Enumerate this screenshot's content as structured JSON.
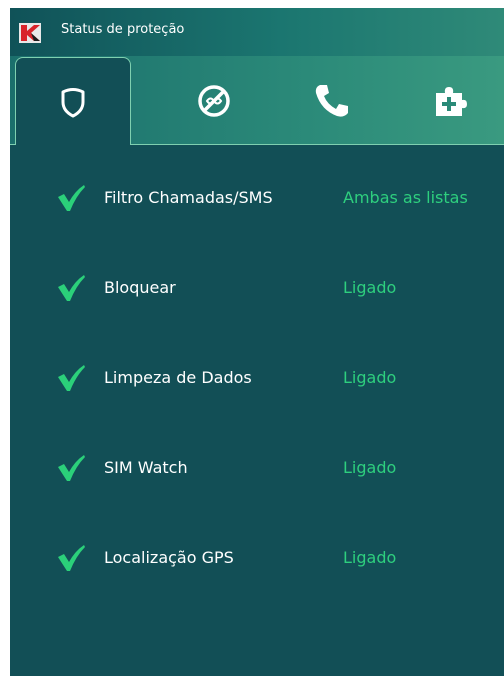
{
  "window": {
    "title": "Status de proteção"
  },
  "tabs": [
    {
      "icon": "shield-icon",
      "active": true
    },
    {
      "icon": "antitheft-icon",
      "active": false
    },
    {
      "icon": "phone-icon",
      "active": false
    },
    {
      "icon": "puzzle-plus-icon",
      "active": false
    }
  ],
  "features": [
    {
      "label": "Filtro Chamadas/SMS",
      "status": "Ambas as listas"
    },
    {
      "label": "Bloquear",
      "status": "Ligado"
    },
    {
      "label": "Limpeza de Dados",
      "status": "Ligado"
    },
    {
      "label": "SIM Watch",
      "status": "Ligado"
    },
    {
      "label": "Localização GPS",
      "status": "Ligado"
    }
  ],
  "colors": {
    "background": "#124f56",
    "status_text": "#2ecf7e",
    "check": "#2bd07a",
    "tab_border": "#7fd0b0"
  }
}
